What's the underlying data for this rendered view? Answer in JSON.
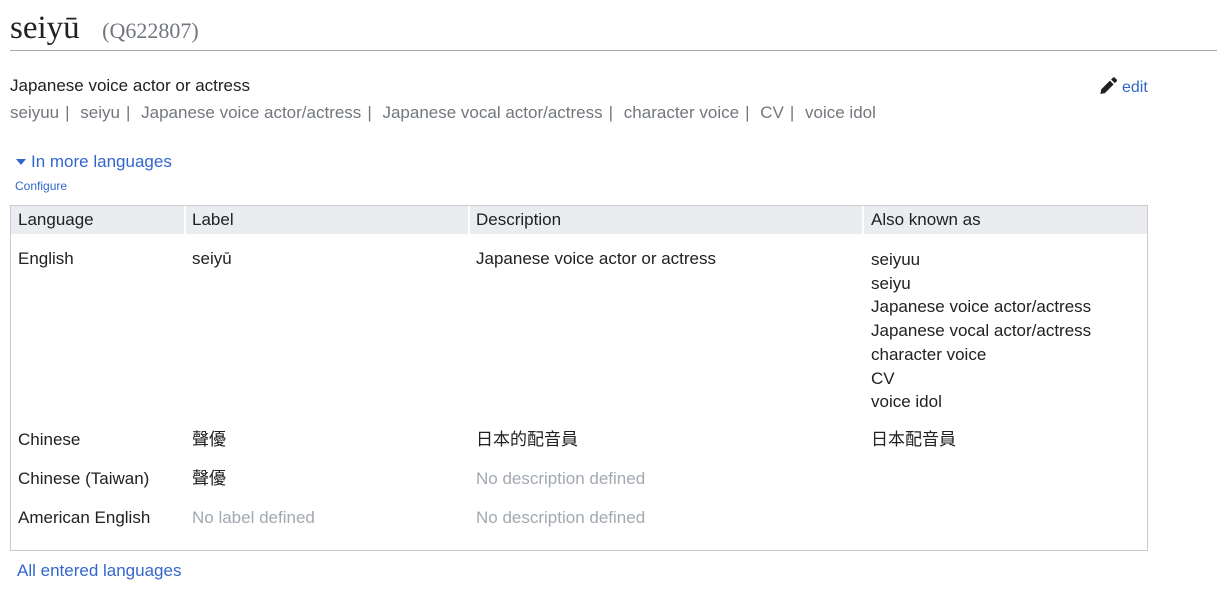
{
  "header": {
    "title": "seiyū",
    "qid": "(Q622807)"
  },
  "description": "Japanese voice actor or actress",
  "aliases": [
    "seiyuu",
    "seiyu",
    "Japanese voice actor/actress",
    "Japanese vocal actor/actress",
    "character voice",
    "CV",
    "voice idol"
  ],
  "alias_separator": "|",
  "edit_label": "edit",
  "more_languages_label": "In more languages",
  "configure_label": "Configure",
  "table": {
    "headers": [
      "Language",
      "Label",
      "Description",
      "Also known as"
    ],
    "rows": [
      {
        "language": "English",
        "label": "seiyū",
        "description": "Japanese voice actor or actress",
        "aliases": [
          "seiyuu",
          "seiyu",
          "Japanese voice actor/actress",
          "Japanese vocal actor/actress",
          "character voice",
          "CV",
          "voice idol"
        ]
      },
      {
        "language": "Chinese",
        "label": "聲優",
        "description": "日本的配音員",
        "aliases": [
          "日本配音員"
        ]
      },
      {
        "language": "Chinese (Taiwan)",
        "label": "聲優",
        "description": "No description defined",
        "aliases": []
      },
      {
        "language": "American English",
        "label": "No label defined",
        "description": "No description defined",
        "aliases": []
      }
    ]
  },
  "all_languages_label": "All entered languages",
  "colors": {
    "link": "#3366cc",
    "muted": "#72777d",
    "placeholder": "#a2a9b1",
    "header_bg": "#eaecf0"
  },
  "icons": {
    "edit": "pencil-icon",
    "expand": "triangle-down-icon"
  }
}
